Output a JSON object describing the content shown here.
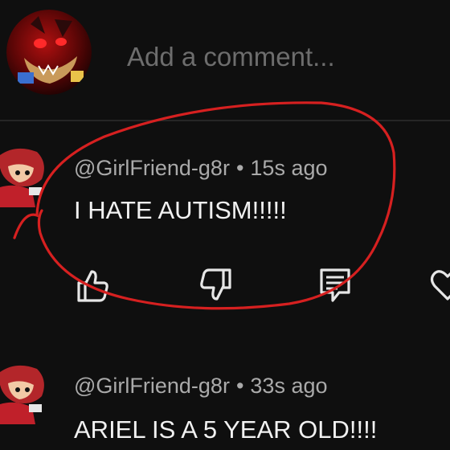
{
  "add_comment": {
    "placeholder": "Add a comment..."
  },
  "comments": [
    {
      "handle": "@GirlFriend-g8r",
      "separator": "•",
      "time": "15s ago",
      "text": "I HATE AUTISM!!!!!"
    },
    {
      "handle": "@GirlFriend-g8r",
      "separator": "•",
      "time": "33s ago",
      "text": "ARIEL IS A 5 YEAR OLD!!!!"
    }
  ],
  "actions": {
    "like_icon": "thumbs-up-icon",
    "dislike_icon": "thumbs-down-icon",
    "reply_icon": "reply-icon",
    "heart_icon": "heart-icon"
  },
  "colors": {
    "background": "#0f0f0f",
    "placeholder": "#6d6d6d",
    "meta": "#aaaaaa",
    "text": "#f1f1f1",
    "icon": "#e6e6e6",
    "annotation": "#d62020"
  }
}
